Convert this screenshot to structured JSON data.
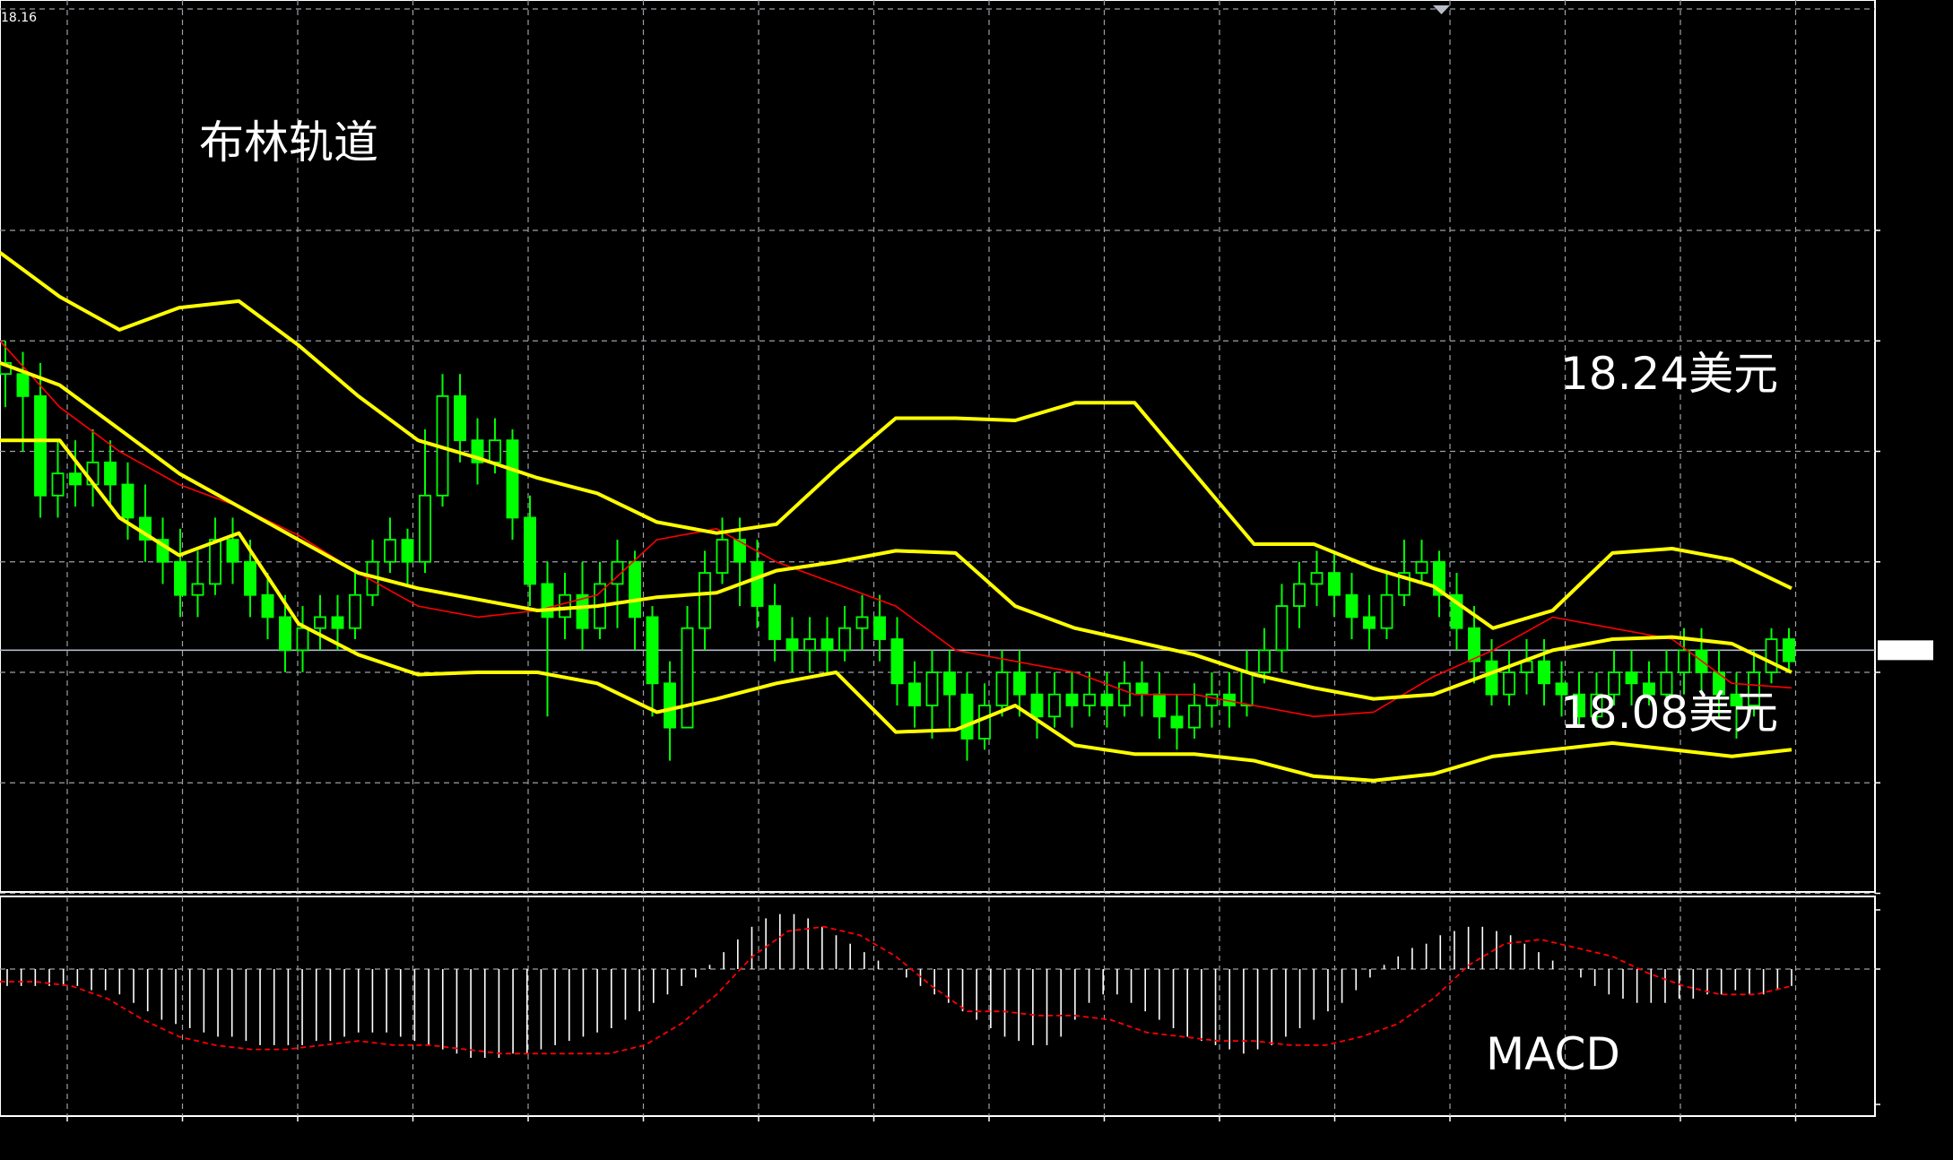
{
  "chart_data": [
    {
      "type": "candlestick",
      "current_price_label": "18.16",
      "current_price": 18.16,
      "ylim": [
        18.0,
        18.4
      ],
      "y_ticks": [
        "18.05",
        "18.10",
        "18.15",
        "18.20",
        "18.25",
        "18.30",
        "18.35"
      ],
      "x_ticks": [
        "19 Apr 06:00",
        "19 Apr 08:00",
        "19 Apr 10:00",
        "19 Apr 12:00",
        "19 Apr 14:00",
        "19 Apr 16:00",
        "19 Apr 18:00",
        "19 Apr 20:00",
        "19 Apr 22:00",
        "20 Apr 00:00",
        "20 Apr 02:00",
        "20 Apr 04:00",
        "20 Apr 06:00",
        "20 Apr 08:00",
        "20 Apr 10:00",
        "20 Apr 12:00",
        "20 Apr 14:00"
      ],
      "annotations": {
        "title": "布林轨道",
        "upper_note": "18.24美元",
        "lower_note": "18.08美元"
      },
      "colors": {
        "candle": "#00ff00",
        "bollinger": "#ffff00",
        "middle": "#ff0000",
        "grid": "#9aa0a6",
        "background": "#000000"
      },
      "grid": true,
      "bollinger_upper": [
        18.34,
        18.32,
        18.305,
        18.315,
        18.318,
        18.298,
        18.275,
        18.255,
        18.247,
        18.238,
        18.231,
        18.218,
        18.213,
        18.217,
        18.242,
        18.265,
        18.265,
        18.264,
        18.272,
        18.272,
        18.24,
        18.208,
        18.208,
        18.197,
        18.189,
        18.17,
        18.178,
        18.204,
        18.206,
        18.201,
        18.188
      ],
      "bollinger_middle": [
        18.29,
        18.28,
        18.26,
        18.24,
        18.225,
        18.21,
        18.195,
        18.188,
        18.183,
        18.178,
        18.18,
        18.184,
        18.186,
        18.196,
        18.2,
        18.205,
        18.204,
        18.18,
        18.17,
        18.164,
        18.158,
        18.149,
        18.143,
        18.138,
        18.14,
        18.15,
        18.16,
        18.165,
        18.166,
        18.163,
        18.15
      ],
      "bollinger_lower": [
        18.255,
        18.255,
        18.22,
        18.203,
        18.213,
        18.172,
        18.158,
        18.149,
        18.15,
        18.15,
        18.145,
        18.132,
        18.138,
        18.145,
        18.15,
        18.123,
        18.124,
        18.135,
        18.117,
        18.113,
        18.113,
        18.11,
        18.103,
        18.101,
        18.104,
        18.112,
        18.115,
        18.118,
        18.115,
        18.112,
        18.115
      ],
      "ma_red": [
        18.3,
        18.27,
        18.25,
        18.235,
        18.225,
        18.212,
        18.195,
        18.18,
        18.175,
        18.178,
        18.185,
        18.21,
        18.215,
        18.2,
        18.19,
        18.18,
        18.16,
        18.155,
        18.15,
        18.14,
        18.14,
        18.135,
        18.13,
        18.132,
        18.148,
        18.16,
        18.175,
        18.17,
        18.165,
        18.145,
        18.143
      ],
      "candles": [
        [
          18.285,
          18.29,
          18.3,
          18.27
        ],
        [
          18.285,
          18.275,
          18.295,
          18.25
        ],
        [
          18.275,
          18.23,
          18.29,
          18.22
        ],
        [
          18.23,
          18.24,
          18.255,
          18.22
        ],
        [
          18.24,
          18.235,
          18.255,
          18.225
        ],
        [
          18.235,
          18.245,
          18.26,
          18.225
        ],
        [
          18.245,
          18.235,
          18.255,
          18.225
        ],
        [
          18.235,
          18.22,
          18.245,
          18.21
        ],
        [
          18.22,
          18.21,
          18.235,
          18.2
        ],
        [
          18.21,
          18.2,
          18.22,
          18.19
        ],
        [
          18.2,
          18.185,
          18.215,
          18.175
        ],
        [
          18.185,
          18.19,
          18.205,
          18.175
        ],
        [
          18.19,
          18.21,
          18.22,
          18.185
        ],
        [
          18.21,
          18.2,
          18.22,
          18.19
        ],
        [
          18.2,
          18.185,
          18.21,
          18.175
        ],
        [
          18.185,
          18.175,
          18.195,
          18.165
        ],
        [
          18.175,
          18.16,
          18.185,
          18.15
        ],
        [
          18.16,
          18.17,
          18.18,
          18.15
        ],
        [
          18.17,
          18.175,
          18.185,
          18.16
        ],
        [
          18.175,
          18.17,
          18.185,
          18.16
        ],
        [
          18.17,
          18.185,
          18.195,
          18.165
        ],
        [
          18.185,
          18.2,
          18.21,
          18.18
        ],
        [
          18.2,
          18.21,
          18.22,
          18.195
        ],
        [
          18.21,
          18.2,
          18.215,
          18.19
        ],
        [
          18.2,
          18.23,
          18.26,
          18.195
        ],
        [
          18.23,
          18.275,
          18.285,
          18.225
        ],
        [
          18.275,
          18.255,
          18.285,
          18.245
        ],
        [
          18.255,
          18.245,
          18.265,
          18.235
        ],
        [
          18.245,
          18.255,
          18.265,
          18.24
        ],
        [
          18.255,
          18.22,
          18.26,
          18.21
        ],
        [
          18.22,
          18.19,
          18.23,
          18.18
        ],
        [
          18.19,
          18.175,
          18.2,
          18.13
        ],
        [
          18.175,
          18.185,
          18.195,
          18.165
        ],
        [
          18.185,
          18.17,
          18.2,
          18.16
        ],
        [
          18.17,
          18.19,
          18.2,
          18.165
        ],
        [
          18.19,
          18.2,
          18.21,
          18.17
        ],
        [
          18.2,
          18.175,
          18.205,
          18.16
        ],
        [
          18.175,
          18.145,
          18.18,
          18.13
        ],
        [
          18.145,
          18.125,
          18.155,
          18.11
        ],
        [
          18.125,
          18.17,
          18.18,
          18.13
        ],
        [
          18.17,
          18.195,
          18.205,
          18.16
        ],
        [
          18.195,
          18.21,
          18.22,
          18.19
        ],
        [
          18.21,
          18.2,
          18.22,
          18.18
        ],
        [
          18.2,
          18.18,
          18.21,
          18.17
        ],
        [
          18.18,
          18.165,
          18.19,
          18.155
        ],
        [
          18.165,
          18.16,
          18.175,
          18.15
        ],
        [
          18.16,
          18.165,
          18.175,
          18.15
        ],
        [
          18.165,
          18.16,
          18.175,
          18.15
        ],
        [
          18.16,
          18.17,
          18.18,
          18.155
        ],
        [
          18.17,
          18.175,
          18.185,
          18.16
        ],
        [
          18.175,
          18.165,
          18.185,
          18.155
        ],
        [
          18.165,
          18.145,
          18.175,
          18.135
        ],
        [
          18.145,
          18.135,
          18.155,
          18.125
        ],
        [
          18.135,
          18.15,
          18.16,
          18.12
        ],
        [
          18.15,
          18.14,
          18.16,
          18.125
        ],
        [
          18.14,
          18.12,
          18.15,
          18.11
        ],
        [
          18.12,
          18.135,
          18.145,
          18.115
        ],
        [
          18.135,
          18.15,
          18.16,
          18.13
        ],
        [
          18.15,
          18.14,
          18.16,
          18.13
        ],
        [
          18.14,
          18.13,
          18.15,
          18.12
        ],
        [
          18.13,
          18.14,
          18.15,
          18.125
        ],
        [
          18.14,
          18.135,
          18.15,
          18.125
        ],
        [
          18.135,
          18.14,
          18.15,
          18.13
        ],
        [
          18.14,
          18.135,
          18.15,
          18.125
        ],
        [
          18.135,
          18.145,
          18.155,
          18.13
        ],
        [
          18.145,
          18.14,
          18.155,
          18.13
        ],
        [
          18.14,
          18.13,
          18.15,
          18.12
        ],
        [
          18.13,
          18.125,
          18.14,
          18.115
        ],
        [
          18.125,
          18.135,
          18.145,
          18.12
        ],
        [
          18.135,
          18.14,
          18.15,
          18.125
        ],
        [
          18.14,
          18.135,
          18.15,
          18.125
        ],
        [
          18.135,
          18.15,
          18.16,
          18.13
        ],
        [
          18.15,
          18.16,
          18.17,
          18.145
        ],
        [
          18.16,
          18.18,
          18.19,
          18.15
        ],
        [
          18.18,
          18.19,
          18.2,
          18.17
        ],
        [
          18.19,
          18.195,
          18.205,
          18.18
        ],
        [
          18.195,
          18.185,
          18.205,
          18.175
        ],
        [
          18.185,
          18.175,
          18.195,
          18.165
        ],
        [
          18.175,
          18.17,
          18.185,
          18.16
        ],
        [
          18.17,
          18.185,
          18.195,
          18.165
        ],
        [
          18.185,
          18.195,
          18.21,
          18.18
        ],
        [
          18.195,
          18.2,
          18.21,
          18.19
        ],
        [
          18.2,
          18.185,
          18.205,
          18.175
        ],
        [
          18.185,
          18.17,
          18.195,
          18.16
        ],
        [
          18.17,
          18.155,
          18.18,
          18.145
        ],
        [
          18.155,
          18.14,
          18.165,
          18.135
        ],
        [
          18.14,
          18.15,
          18.16,
          18.135
        ],
        [
          18.15,
          18.155,
          18.165,
          18.14
        ],
        [
          18.155,
          18.145,
          18.165,
          18.135
        ],
        [
          18.145,
          18.14,
          18.155,
          18.13
        ],
        [
          18.14,
          18.13,
          18.15,
          18.125
        ],
        [
          18.13,
          18.14,
          18.15,
          18.125
        ],
        [
          18.14,
          18.15,
          18.16,
          18.135
        ],
        [
          18.15,
          18.145,
          18.16,
          18.135
        ],
        [
          18.145,
          18.14,
          18.155,
          18.135
        ],
        [
          18.14,
          18.15,
          18.16,
          18.135
        ],
        [
          18.15,
          18.16,
          18.17,
          18.14
        ],
        [
          18.16,
          18.15,
          18.17,
          18.14
        ],
        [
          18.15,
          18.14,
          18.16,
          18.13
        ],
        [
          18.14,
          18.135,
          18.15,
          18.12
        ],
        [
          18.135,
          18.15,
          18.16,
          18.13
        ],
        [
          18.15,
          18.165,
          18.17,
          18.145
        ],
        [
          18.165,
          18.155,
          18.17,
          18.15
        ]
      ]
    },
    {
      "type": "macd",
      "title": "MACD",
      "ylim": [
        -0.035,
        0.017
      ],
      "y_ticks": [
        "0.014",
        "0.00",
        "-0.03"
      ],
      "colors": {
        "histogram": "#ffffff",
        "signal": "#ff0000"
      },
      "histogram": [
        -0.004,
        -0.004,
        -0.004,
        -0.004,
        -0.004,
        -0.004,
        -0.005,
        -0.005,
        -0.006,
        -0.008,
        -0.01,
        -0.012,
        -0.013,
        -0.014,
        -0.015,
        -0.016,
        -0.016,
        -0.017,
        -0.018,
        -0.018,
        -0.018,
        -0.018,
        -0.017,
        -0.017,
        -0.016,
        -0.015,
        -0.015,
        -0.015,
        -0.016,
        -0.017,
        -0.018,
        -0.019,
        -0.02,
        -0.021,
        -0.021,
        -0.021,
        -0.02,
        -0.02,
        -0.019,
        -0.018,
        -0.017,
        -0.016,
        -0.015,
        -0.014,
        -0.012,
        -0.01,
        -0.008,
        -0.006,
        -0.004,
        -0.002,
        0.001,
        0.004,
        0.007,
        0.01,
        0.012,
        0.013,
        0.013,
        0.012,
        0.01,
        0.008,
        0.006,
        0.004,
        0.002,
        0.0,
        -0.002,
        -0.004,
        -0.006,
        -0.008,
        -0.01,
        -0.012,
        -0.014,
        -0.016,
        -0.017,
        -0.018,
        -0.018,
        -0.016,
        -0.012,
        -0.008,
        -0.006,
        -0.006,
        -0.008,
        -0.01,
        -0.012,
        -0.014,
        -0.016,
        -0.017,
        -0.018,
        -0.019,
        -0.02,
        -0.019,
        -0.018,
        -0.016,
        -0.014,
        -0.012,
        -0.01,
        -0.008,
        -0.005,
        -0.002,
        0.001,
        0.003,
        0.005,
        0.006,
        0.008,
        0.009,
        0.01,
        0.01,
        0.009,
        0.008,
        0.006,
        0.004,
        0.002,
        0.0,
        -0.002,
        -0.004,
        -0.006,
        -0.007,
        -0.008,
        -0.008,
        -0.008,
        -0.007,
        -0.007,
        -0.006,
        -0.006,
        -0.005,
        -0.006,
        -0.006,
        -0.005,
        -0.004
      ],
      "signal": [
        -0.003,
        -0.003,
        -0.004,
        -0.007,
        -0.012,
        -0.016,
        -0.018,
        -0.019,
        -0.019,
        -0.018,
        -0.017,
        -0.018,
        -0.018,
        -0.019,
        -0.02,
        -0.02,
        -0.02,
        -0.02,
        -0.018,
        -0.013,
        -0.006,
        0.003,
        0.009,
        0.01,
        0.008,
        0.003,
        -0.004,
        -0.01,
        -0.01,
        -0.011,
        -0.011,
        -0.012,
        -0.015,
        -0.016,
        -0.017,
        -0.017,
        -0.018,
        -0.018,
        -0.016,
        -0.013,
        -0.007,
        0.001,
        0.006,
        0.007,
        0.005,
        0.003,
        -0.001,
        -0.004,
        -0.006,
        -0.006,
        -0.004
      ]
    }
  ]
}
